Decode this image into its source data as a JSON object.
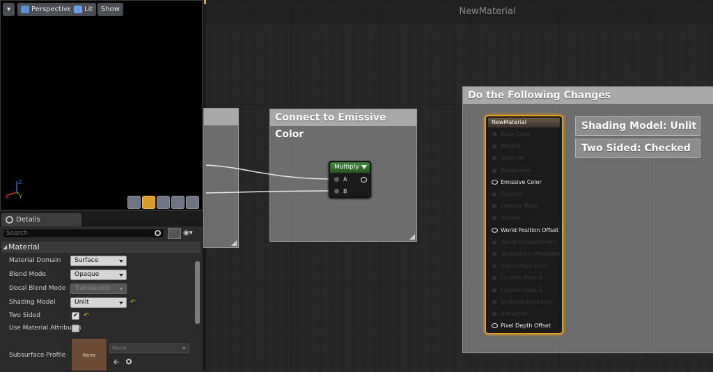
{
  "viewport": {
    "menu_arrow": "▾",
    "perspective_label": "Perspective",
    "lit_label": "Lit",
    "show_label": "Show",
    "axis_z": "Z",
    "axis_x": "X",
    "axis_y": "Y"
  },
  "details": {
    "tab_label": "Details",
    "search_placeholder": "Search",
    "section_title": "Material",
    "props": [
      {
        "label": "Material Domain",
        "value": "Surface"
      },
      {
        "label": "Blend Mode",
        "value": "Opaque"
      },
      {
        "label": "Decal Blend Mode",
        "value": "Translucent"
      },
      {
        "label": "Shading Model",
        "value": "Unlit"
      },
      {
        "label": "Two Sided",
        "checked": true
      },
      {
        "label": "Use Material Attributes",
        "checked": false
      },
      {
        "label": "Subsurface Profile",
        "thumb_label": "None",
        "asset_value": "None"
      }
    ],
    "reset_glyph": "↶",
    "check_glyph": "✔"
  },
  "graph": {
    "title": "NewMaterial",
    "comment_connect": "Connect to Emissive Color",
    "comment_changes": "Do the Following Changes",
    "multiply": {
      "title": "Multiply",
      "pin_a": "A",
      "pin_b": "B"
    },
    "material_node": {
      "title": "NewMaterial",
      "pins": [
        {
          "label": "Base Color",
          "active": false
        },
        {
          "label": "Metallic",
          "active": false
        },
        {
          "label": "Specular",
          "active": false
        },
        {
          "label": "Roughness",
          "active": false
        },
        {
          "label": "Emissive Color",
          "active": true
        },
        {
          "label": "Opacity",
          "active": false
        },
        {
          "label": "Opacity Mask",
          "active": false
        },
        {
          "label": "Normal",
          "active": false
        },
        {
          "label": "World Position Offset",
          "active": true
        },
        {
          "label": "World Displacement",
          "active": false
        },
        {
          "label": "Tessellation Multiplier",
          "active": false
        },
        {
          "label": "Subsurface Color",
          "active": false
        },
        {
          "label": "Custom Data 0",
          "active": false
        },
        {
          "label": "Custom Data 1",
          "active": false
        },
        {
          "label": "Ambient Occlusion",
          "active": false
        },
        {
          "label": "Refraction",
          "active": false
        },
        {
          "label": "Pixel Depth Offset",
          "active": true
        }
      ]
    },
    "changes": [
      "Shading Model: Unlit",
      "Two Sided: Checked"
    ]
  },
  "colors": {
    "selection_orange": "#e89b1b",
    "multiply_header": "#3f8a3c",
    "comment_gray": "#a8a8a8"
  }
}
